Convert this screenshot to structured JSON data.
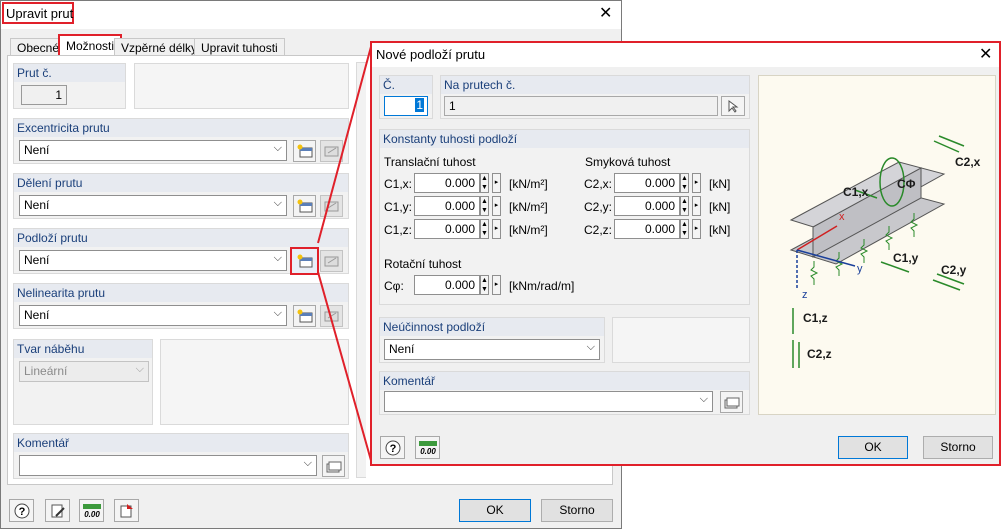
{
  "main_dialog": {
    "title": "Upravit prut",
    "tabs": [
      "Obecné",
      "Možnosti",
      "Vzpěrné délky",
      "Upravit tuhosti"
    ],
    "member_no": {
      "label": "Prut č.",
      "value": "1"
    },
    "eccentricity": {
      "label": "Excentricita prutu",
      "value": "Není"
    },
    "division": {
      "label": "Dělení prutu",
      "value": "Není"
    },
    "foundation": {
      "label": "Podloží prutu",
      "value": "Není"
    },
    "nonlinearity": {
      "label": "Nelinearita prutu",
      "value": "Není"
    },
    "taper": {
      "label": "Tvar náběhu",
      "value": "Lineární"
    },
    "comment": {
      "label": "Komentář",
      "value": ""
    },
    "ok_label": "OK",
    "cancel_label": "Storno"
  },
  "sub_dialog": {
    "title": "Nové podloží prutu",
    "no_label": "Č.",
    "no_value": "1",
    "on_members_label": "Na prutech č.",
    "on_members_value": "1",
    "stiffness_group_label": "Konstanty tuhosti podloží",
    "translational_label": "Translační tuhost",
    "shear_label": "Smyková tuhost",
    "rotational_label": "Rotační tuhost",
    "c1x": {
      "name": "C1,x:",
      "value": "0.000",
      "unit": "[kN/m²]"
    },
    "c1y": {
      "name": "C1,y:",
      "value": "0.000",
      "unit": "[kN/m²]"
    },
    "c1z": {
      "name": "C1,z:",
      "value": "0.000",
      "unit": "[kN/m²]"
    },
    "c2x": {
      "name": "C2,x:",
      "value": "0.000",
      "unit": "[kN]"
    },
    "c2y": {
      "name": "C2,y:",
      "value": "0.000",
      "unit": "[kN]"
    },
    "c2z": {
      "name": "C2,z:",
      "value": "0.000",
      "unit": "[kN]"
    },
    "cphi": {
      "name": "Cφ:",
      "value": "0.000",
      "unit": "[kNm/rad/m]"
    },
    "ineffective_label": "Neúčinnost podloží",
    "ineffective_value": "Není",
    "comment_label": "Komentář",
    "comment_value": "",
    "ok_label": "OK",
    "cancel_label": "Storno",
    "diagram_labels": {
      "c2x": "C2,x",
      "c1x": "C1,x",
      "cphi": "CΦ",
      "x": "x",
      "y": "y",
      "z": "z",
      "c1y": "C1,y",
      "c2y": "C2,y",
      "c1z": "C1,z",
      "c2z": "C2,z"
    }
  },
  "colors": {
    "highlight_red": "#e0202a",
    "group_header": "#1a3f7a",
    "arrow_green": "#2a8a2a",
    "axis_red": "#d02020",
    "axis_blue": "#1a3f9a"
  },
  "icons": [
    "close-icon",
    "new-icon",
    "edit-icon",
    "help-icon",
    "units-icon",
    "select-icon",
    "chevron-down-icon",
    "spin-up-icon",
    "spin-down-icon",
    "spin-right-icon"
  ]
}
